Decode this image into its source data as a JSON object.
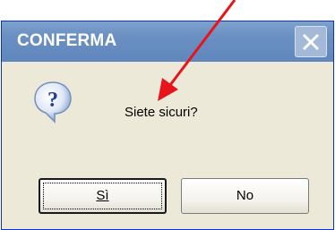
{
  "dialog": {
    "title": "CONFERMA",
    "message": "Siete sicuri?",
    "buttons": {
      "yes_label": "Sì",
      "no_label": "No"
    },
    "icons": {
      "message_icon": "question-icon",
      "close_icon": "close-icon"
    }
  },
  "colors": {
    "annotation_arrow": "#e8141c",
    "titlebar": "#6b90c2",
    "dialog_background": "#ece9d8"
  }
}
